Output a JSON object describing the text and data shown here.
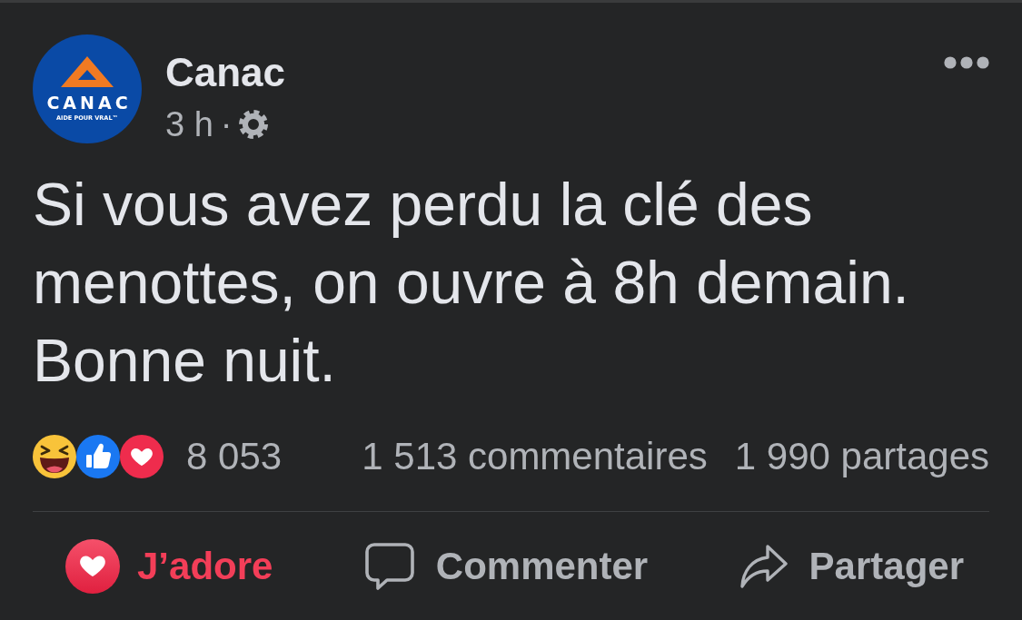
{
  "post": {
    "author": {
      "name": "Canac",
      "avatar": {
        "wordmark": "CANAC",
        "tagline": "AIDE POUR VRAL™"
      }
    },
    "time": "3 h",
    "separator": "·",
    "text": "Si vous avez perdu la clé des menottes, on ouvre à 8h demain. Bonne nuit.",
    "reactions": {
      "types": [
        {
          "kind": "haha"
        },
        {
          "kind": "like"
        },
        {
          "kind": "love"
        }
      ],
      "count": "8 053"
    },
    "comments": "1 513 commentaires",
    "shares": "1 990 partages",
    "actions": [
      {
        "kind": "react",
        "label": "J’adore",
        "active": true
      },
      {
        "kind": "comment",
        "label": "Commenter",
        "active": false
      },
      {
        "kind": "share",
        "label": "Partager",
        "active": false
      }
    ]
  }
}
